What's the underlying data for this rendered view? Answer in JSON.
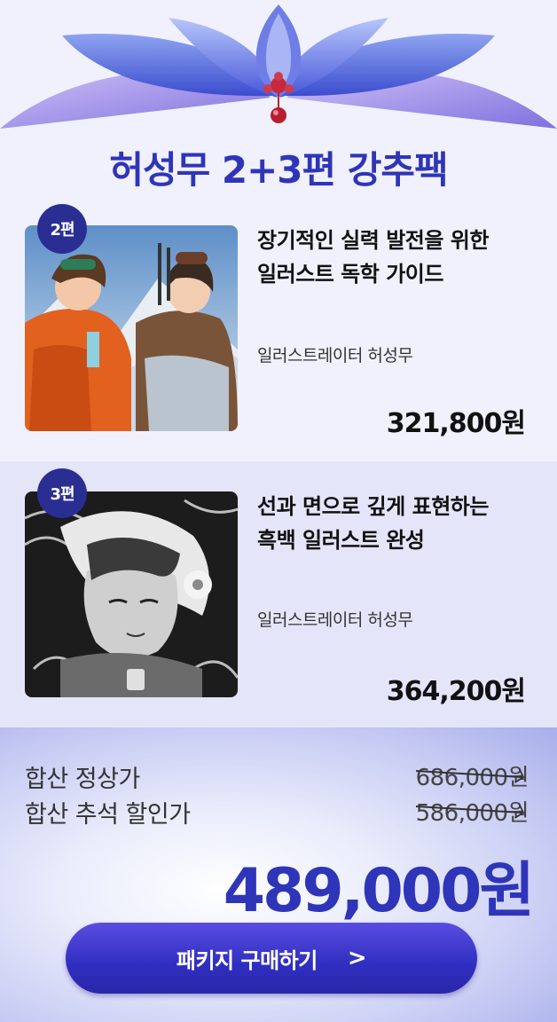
{
  "title": "허성무 2+3편 강추팩",
  "products": [
    {
      "badge": "2편",
      "title_line1": "장기적인 실력 발전을 위한",
      "title_line2": "일러스트 독학 가이드",
      "author": "일러스트레이터 허성무",
      "price": "321,800원"
    },
    {
      "badge": "3편",
      "title_line1": "선과 면으로 깊게 표현하는",
      "title_line2": "흑백 일러스트 완성",
      "author": "일러스트레이터 허성무",
      "price": "364,200원"
    }
  ],
  "summary": {
    "regular_label": "합산 정상가",
    "regular_price": "686,000원",
    "chuseok_label": "합산 추석 할인가",
    "chuseok_price": "586,000원",
    "final_price": "489,000원"
  },
  "buy_button": {
    "label": "패키지 구매하기",
    "arrow": "chevron-right-icon"
  },
  "colors": {
    "accent": "#2f35b8",
    "badge": "#2a2e93",
    "button": "#2f2ec0"
  }
}
